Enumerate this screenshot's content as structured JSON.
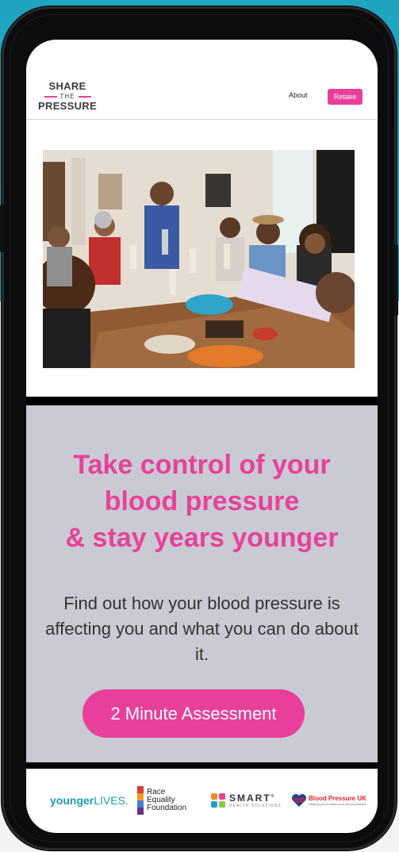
{
  "logo": {
    "top": "SHARE",
    "mid": "THE",
    "bottom": "PRESSURE"
  },
  "nav": {
    "about": "About",
    "retake": "Retake"
  },
  "hero": {
    "image": "family-dinner-toast-photo"
  },
  "cta": {
    "headline_lines": [
      "Take control of your",
      "blood pressure",
      "& stay years younger"
    ],
    "subtext": "Find out how your blood pressure is affecting you and what you can do about it.",
    "button": "2 Minute Assessment"
  },
  "partners": {
    "younger_lives": {
      "bold": "younger",
      "light": "LIVES."
    },
    "race_equality": {
      "lines": [
        "Race",
        "Equality",
        "Foundation"
      ]
    },
    "smart": {
      "name": "SMART",
      "reg": "®",
      "tagline": "HEALTH SOLUTIONS"
    },
    "bp_uk": {
      "name": "Blood Pressure UK",
      "tagline": "Helping you to lower your blood pressure"
    }
  },
  "colors": {
    "accent": "#e8409a",
    "panel": "#c9cad3",
    "teal": "#1fa4bf"
  }
}
